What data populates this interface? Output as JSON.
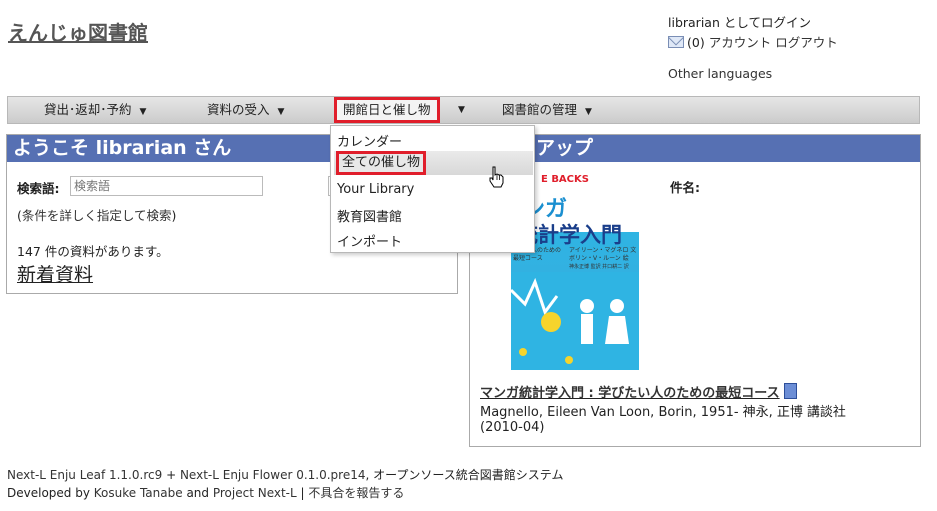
{
  "site": {
    "title": "えんじゅ図書館"
  },
  "login": {
    "status": "librarian としてログイン",
    "messages": "(0)",
    "account": "アカウント",
    "logout": "ログアウト",
    "other_languages": "Other languages"
  },
  "nav": {
    "items": [
      {
        "label": "貸出･返却･予約"
      },
      {
        "label": "資料の受入"
      },
      {
        "label": "開館日と催し物"
      },
      {
        "label": "図書館の管理"
      }
    ],
    "caret": "▼"
  },
  "dropdown": {
    "items": [
      {
        "label": "カレンダー"
      },
      {
        "label": "全ての催し物"
      },
      {
        "label": "Your Library"
      },
      {
        "label": "教育図書館"
      },
      {
        "label": "インポート"
      }
    ]
  },
  "welcome": {
    "heading": "ようこそ librarian さん",
    "search_label": "検索語",
    "search_colon": ":",
    "search_placeholder": "検索語",
    "advanced_open": "(",
    "advanced_link": "条件を詳しく指定して検索",
    "advanced_close": ")",
    "count_text": "147 件の資料があります。",
    "new_items": "新着資料"
  },
  "pickup": {
    "heading": "アップ",
    "subject_label": "件名:",
    "cover": {
      "series": "E BACKS",
      "title_line1": "ンガ",
      "title_line2": "統計学入門",
      "subtitle1": "したい人のための",
      "subtitle2": "最短コース",
      "author1": "アイリーン・マグネロ 文",
      "author2": "ボリン・V・ルーン 絵",
      "translator": "神永正博 監訳  井口耕二 訳"
    },
    "book": {
      "title": "マンガ統計学入門 : 学びたい人のための最短コース",
      "authors": [
        "Magnello, Eileen",
        "Van Loon, Borin, 1951-",
        "神永, 正博",
        "講談社"
      ],
      "date": "(2010-04)"
    }
  },
  "footer": {
    "leaf": "Next-L Enju Leaf 1.1.0.rc9",
    "plus": "+",
    "flower": "Next-L Enju Flower 0.1.0.pre14",
    "desc": ", オープンソース統合図書館システム",
    "developed_by": "Developed by",
    "author": "Kosuke Tanabe",
    "and": "and",
    "project": "Project Next-L",
    "sep": "|",
    "report": "不具合を報告する"
  },
  "colors": {
    "header_blue": "#5670b3",
    "highlight_red": "#e01e2b"
  }
}
